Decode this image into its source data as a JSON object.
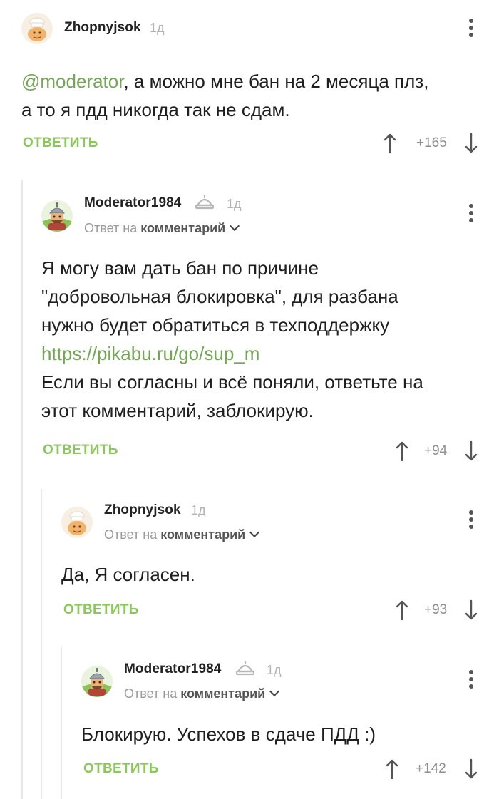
{
  "comments": [
    {
      "username": "Zhopnyjsok",
      "time": "1д",
      "mention": "@moderator",
      "text_lines": [
        ", а можно мне бан на 2 месяца плз,",
        "а то я пдд никогда так не сдам."
      ],
      "reply_label": "ОТВЕТИТЬ",
      "score": "+165"
    },
    {
      "username": "Moderator1984",
      "time": "1д",
      "reply_prefix": "Ответ на",
      "reply_target": "комментарий",
      "text_lines": [
        "Я могу вам дать бан по причине",
        "\"добровольная блокировка\", для разбана",
        "нужно будет обратиться в техподдержку"
      ],
      "link": "https://pikabu.ru/go/sup_m",
      "text_lines_after": [
        "Если вы согласны и всё поняли, ответьте на",
        "этот комментарий, заблокирую."
      ],
      "reply_label": "ОТВЕТИТЬ",
      "score": "+94"
    },
    {
      "username": "Zhopnyjsok",
      "time": "1д",
      "reply_prefix": "Ответ на",
      "reply_target": "комментарий",
      "text": "Да, Я согласен.",
      "reply_label": "ОТВЕТИТЬ",
      "score": "+93"
    },
    {
      "username": "Moderator1984",
      "time": "1д",
      "reply_prefix": "Ответ на",
      "reply_target": "комментарий",
      "text": "Блокирую. Успехов в сдаче ПДД :)",
      "reply_label": "ОТВЕТИТЬ",
      "score": "+142"
    }
  ],
  "colors": {
    "accent_green": "#8ac858",
    "link_green": "#74a654",
    "muted": "#9a9a9a",
    "thread_line": "#e8e8e8"
  },
  "icons": {
    "avatar_user": "chef-avatar-icon",
    "avatar_moderator": "bogatyr-avatar-icon",
    "moderator_badge": "moderator-helmet-icon",
    "menu": "more-vertical-icon",
    "upvote": "arrow-up-icon",
    "downvote": "arrow-down-icon",
    "reply_chevron": "chevron-down-icon"
  }
}
